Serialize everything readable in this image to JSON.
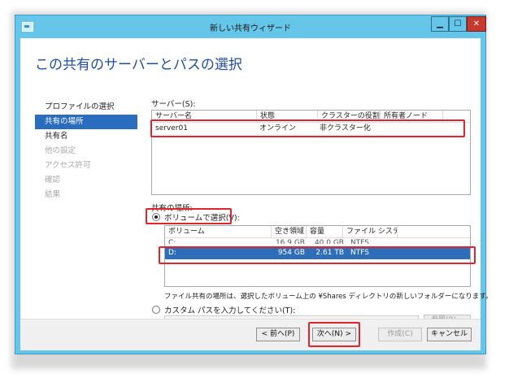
{
  "window": {
    "title": "新しい共有ウィザード"
  },
  "header": {
    "title": "この共有のサーバーとパスの選択"
  },
  "nav": {
    "items": [
      {
        "label": "プロファイルの選択",
        "state": "normal"
      },
      {
        "label": "共有の場所",
        "state": "active"
      },
      {
        "label": "共有名",
        "state": "normal"
      },
      {
        "label": "他の設定",
        "state": "disabled"
      },
      {
        "label": "アクセス許可",
        "state": "disabled"
      },
      {
        "label": "確認",
        "state": "disabled"
      },
      {
        "label": "結果",
        "state": "disabled"
      }
    ]
  },
  "server": {
    "label": "サーバー(S):",
    "columns": [
      "サーバー名",
      "状態",
      "クラスターの役割",
      "所有者ノード"
    ],
    "rows": [
      [
        "server01",
        "オンライン",
        "非クラスター化",
        ""
      ]
    ]
  },
  "location": {
    "label": "共有の場所:",
    "volume_radio_label": "ボリュームで選択(V):",
    "volume_columns": [
      "ボリューム",
      "空き領域",
      "容量",
      "ファイル システム"
    ],
    "volume_rows": [
      {
        "name": "C:",
        "free": "16.9 GB",
        "capacity": "40.0 GB",
        "fs": "NTFS",
        "selected": false
      },
      {
        "name": "D:",
        "free": "954 GB",
        "capacity": "2.61 TB",
        "fs": "NTFS",
        "selected": true
      }
    ],
    "note": "ファイル共有の場所は、選択したボリューム上の ¥Shares ディレクトリの新しいフォルダーになります。",
    "custom_radio_label": "カスタム パスを入力してください(T):",
    "custom_path_value": "",
    "browse_label": "参照(B)..."
  },
  "footer": {
    "prev_label": "< 前へ(P)",
    "next_label": "次へ(N) >",
    "create_label": "作成(C)",
    "cancel_label": "キャンセル"
  },
  "colors": {
    "title_bar": "#66c6e9",
    "accent_blue": "#2a6cbd",
    "highlight_red": "#e0232d"
  }
}
